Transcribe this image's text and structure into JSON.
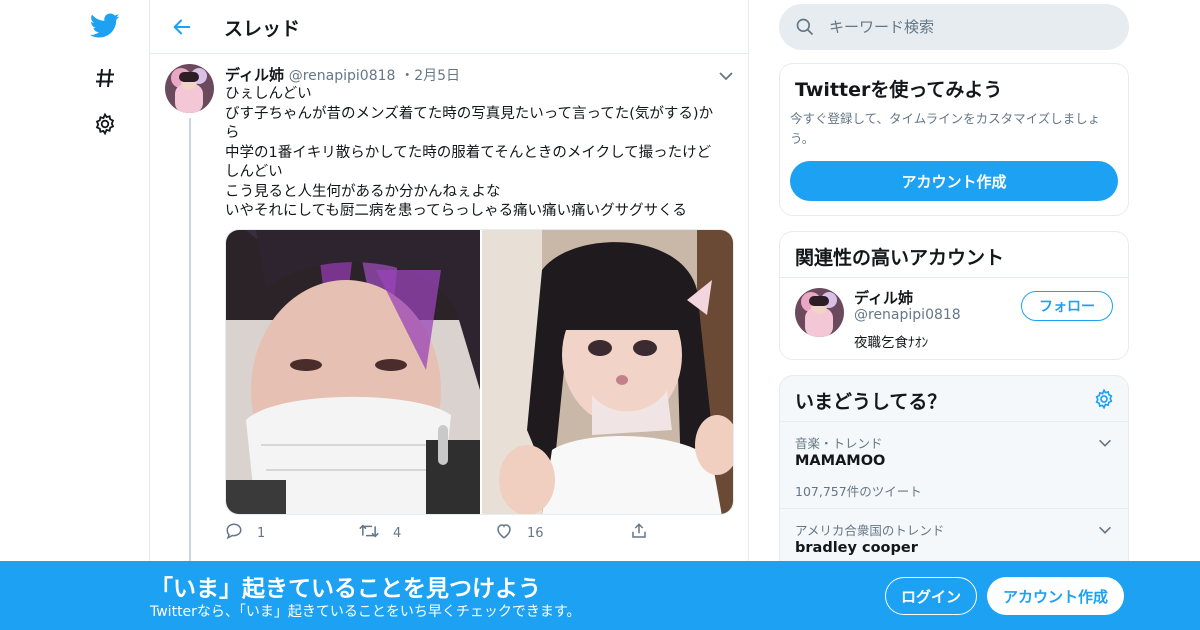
{
  "nav": {
    "icons": [
      "twitter-bird-icon",
      "hashtag-icon",
      "gear-icon"
    ]
  },
  "thread": {
    "title": "スレッド"
  },
  "tweet": {
    "name": "ディル姉",
    "handle": "@renapipi0818",
    "dot": "・",
    "date": "2月5日",
    "lines": [
      "ひぇしんどい",
      "びす子ちゃんが昔のメンズ着てた時の写真見たいって言ってた(気がする)か",
      "ら",
      "中学の1番イキリ散らかしてた時の服着てそんときのメイクして撮ったけど",
      "しんどい",
      "こう見ると人生何があるか分かんねぇよな",
      "いやそれにしても厨二病を患ってらっしゃる痛い痛い痛いグサグサくる"
    ],
    "replies": "1",
    "retweets": "4",
    "likes": "16"
  },
  "search": {
    "placeholder": "キーワード検索"
  },
  "try_card": {
    "title": "Twitterを使ってみよう",
    "desc": "今すぐ登録して、タイムラインをカスタマイズしましょう。",
    "signup_label": "アカウント作成"
  },
  "related": {
    "title": "関連性の高いアカウント",
    "name": "ディル姉",
    "handle": "@renapipi0818",
    "bio": "夜職乞食ﾅｵﾝ",
    "follow_label": "フォロー"
  },
  "trends": {
    "title": "いまどうしてる？",
    "items": [
      {
        "context": "音楽・トレンド",
        "name": "MAMAMOO",
        "count": "107,757件のツイート"
      },
      {
        "context": "アメリカ合衆国のトレンド",
        "name": "bradley cooper",
        "count": ""
      }
    ]
  },
  "banner": {
    "title": "「いま」起きていることを見つけよう",
    "subtitle": "Twitterなら、「いま」起きていることをいち早くチェックできます。",
    "login_label": "ログイン",
    "signup_label": "アカウント作成"
  },
  "colors": {
    "accent": "#1da1f2",
    "text": "#14171a",
    "muted": "#657786",
    "border": "#e6ecf0"
  }
}
